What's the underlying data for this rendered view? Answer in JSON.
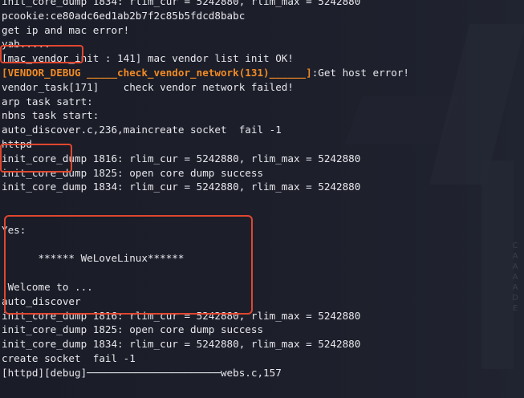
{
  "terminal": {
    "lines": [
      "init_core_dump 1834: rlim_cur = 5242880, rlim_max = 5242880",
      "pcookie:ce80adc6ed1ab2b7f2c85b5fdcd8babc",
      "get ip and mac error!",
      "yab.....",
      "[mac_vendor_init : 141] mac vendor list init OK!",
      {
        "orange": "[VENDOR_DEBUG _____check_vendor_network(131)______]",
        "rest": ":Get host error!"
      },
      "vendor_task[171]    check vendor network failed!",
      "arp task satrt:",
      "nbns task start:",
      "auto_discover.c,236,maincreate socket  fail -1",
      "httpd",
      "init_core_dump 1816: rlim_cur = 5242880, rlim_max = 5242880",
      "init_core_dump 1825: open core dump success",
      "init_core_dump 1834: rlim_cur = 5242880, rlim_max = 5242880",
      "",
      "",
      "Yes:",
      "",
      "      ****** WeLoveLinux******",
      "",
      " Welcome to ...",
      "auto_discover",
      "init_core_dump 1816: rlim_cur = 5242880, rlim_max = 5242880",
      "init_core_dump 1825: open core dump success",
      "init_core_dump 1834: rlim_cur = 5242880, rlim_max = 5242880",
      "create socket  fail -1",
      "[httpd][debug]──────────────────────webs.c,157"
    ]
  },
  "colors": {
    "background": "#1b1d28",
    "text": "#e7e7ec",
    "debug_highlight": "#f08a24",
    "annotation_box": "#e0472f"
  }
}
